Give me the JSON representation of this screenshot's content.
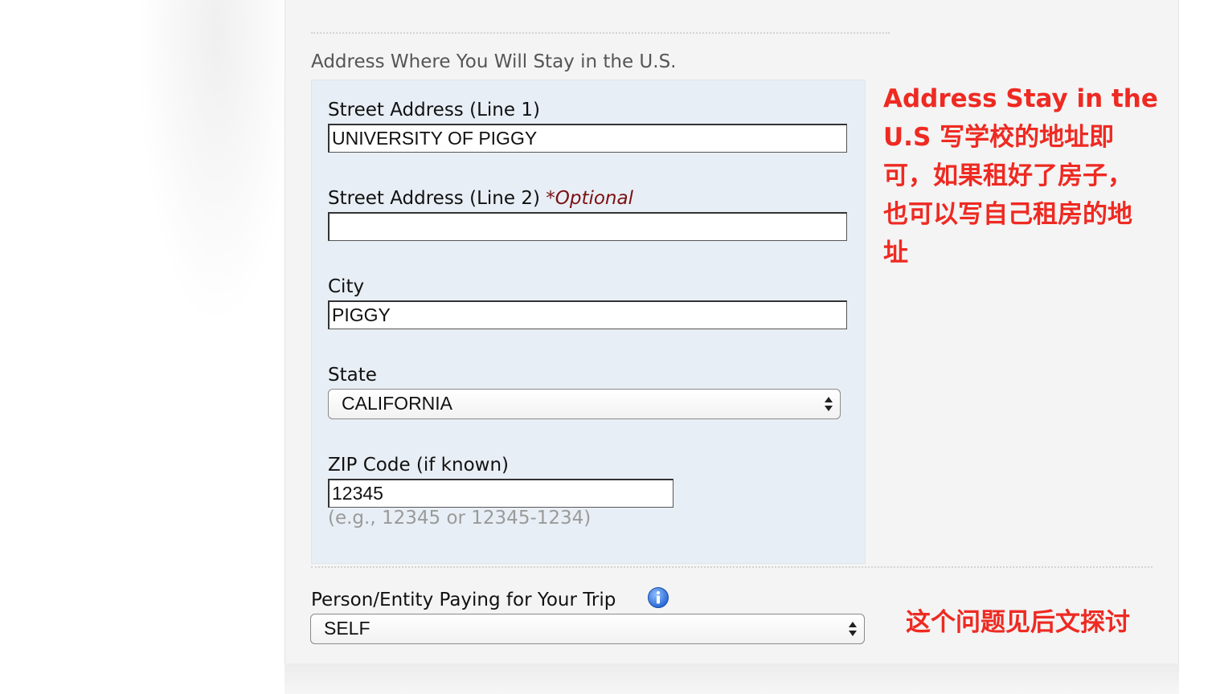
{
  "section": {
    "title": "Address Where You Will Stay in the U.S."
  },
  "fields": {
    "street1": {
      "label": "Street Address (Line 1)",
      "value": "UNIVERSITY OF PIGGY"
    },
    "street2": {
      "label": "Street Address (Line 2)",
      "optional": "*Optional",
      "value": ""
    },
    "city": {
      "label": "City",
      "value": "PIGGY"
    },
    "state": {
      "label": "State",
      "value": "CALIFORNIA"
    },
    "zip": {
      "label": "ZIP Code (if known)",
      "value": "12345",
      "hint": "(e.g., 12345 or 12345-1234)"
    }
  },
  "payer": {
    "label": "Person/Entity Paying for Your Trip",
    "value": "SELF",
    "info_icon": "info-icon"
  },
  "annotations": {
    "address_note_lines": [
      "Address Stay in the",
      "U.S 写学校的地址即",
      "可，如果租好了房子，",
      "也可以写自己租房的地",
      "址"
    ],
    "payer_note": "这个问题见后文探讨",
    "color": "#ee2a22"
  }
}
